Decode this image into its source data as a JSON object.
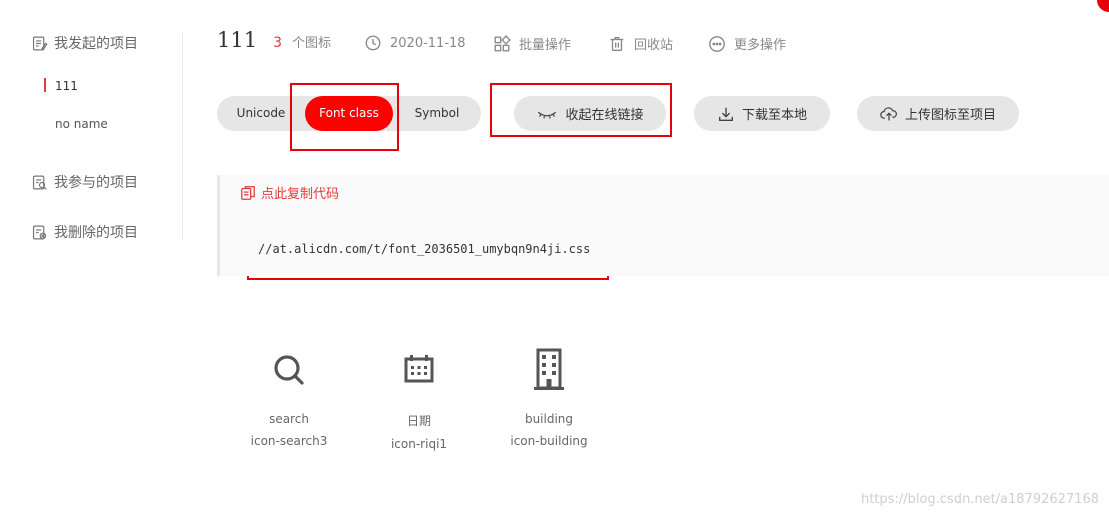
{
  "sidebar": {
    "groups": [
      {
        "label": "我发起的项目",
        "icon": "project-doc-icon"
      },
      {
        "label": "我参与的项目",
        "icon": "project-search-icon"
      },
      {
        "label": "我删除的项目",
        "icon": "project-delete-icon"
      }
    ],
    "projects": [
      {
        "label": "111",
        "active": true
      },
      {
        "label": "no name",
        "active": false
      }
    ]
  },
  "header": {
    "title": "111",
    "icon_count": "3",
    "icon_count_label": "个图标",
    "date": "2020-11-18",
    "batch_label": "批量操作",
    "trash_label": "回收站",
    "more_label": "更多操作"
  },
  "tabs": [
    {
      "label": "Unicode",
      "active": false
    },
    {
      "label": "Font class",
      "active": true
    },
    {
      "label": "Symbol",
      "active": false
    }
  ],
  "actions": {
    "collapse_label": "收起在线链接",
    "download_label": "下载至本地",
    "upload_label": "上传图标至项目"
  },
  "code": {
    "copy_label": "点此复制代码",
    "url": "//at.alicdn.com/t/font_2036501_umybqn9n4ji.css"
  },
  "icons": [
    {
      "name": "search",
      "class": "icon-search3",
      "glyph": "search-icon"
    },
    {
      "name": "日期",
      "class": "icon-riqi1",
      "glyph": "calendar-icon"
    },
    {
      "name": "building",
      "class": "icon-building",
      "glyph": "building-icon"
    }
  ],
  "watermark": "https://blog.csdn.net/a18792627168",
  "colors": {
    "accent": "#ff0000",
    "highlight_box": "#e4000f",
    "pill_bg": "#e6e6e6"
  }
}
